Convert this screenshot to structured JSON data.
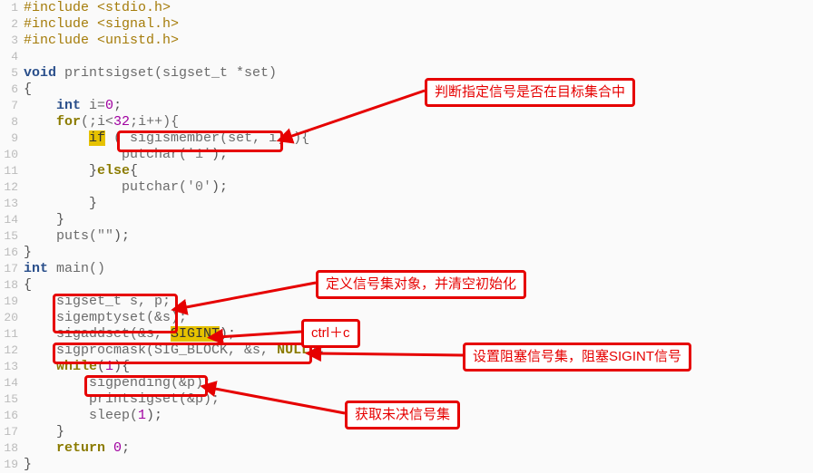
{
  "code": {
    "l1": "#include <stdio.h>",
    "l2": "#include <signal.h>",
    "l3": "#include <unistd.h>",
    "l4": "",
    "l5a": "void",
    "l5b": " printsigset(sigset_t *set)",
    "l6": "{",
    "l7a": "    ",
    "l7b": "int",
    "l7c": " i=",
    "l7d": "0",
    "l7e": ";",
    "l8a": "    ",
    "l8b": "for",
    "l8c": "(;i<",
    "l8d": "32",
    "l8e": ";i++){",
    "l9a": "        ",
    "l9b": "if",
    "l9c": " ( ",
    "l9d": "sigismember(set, i)",
    "l9e": " ){",
    "l10a": "            putchar(",
    "l10b": "'1'",
    "l10c": ");",
    "l11a": "        }",
    "l11b": "else",
    "l11c": "{",
    "l12a": "            putchar(",
    "l12b": "'0'",
    "l12c": ");",
    "l13": "        }",
    "l14": "    }",
    "l15a": "    puts(",
    "l15b": "\"\"",
    "l15c": ");",
    "l16": "}",
    "l17a": "int",
    "l17b": " main()",
    "l18": "{",
    "l19": "    sigset_t s, p;",
    "l20": "    sigemptyset(&s);",
    "l21a": "    sigaddset(&s, ",
    "l21b": "SIGINT",
    "l21c": ");",
    "l22a": "    ",
    "l22b": "sigprocmask(SIG_BLOCK, &s, ",
    "l22c": "NULL",
    "l22d": ")",
    "l22e": ";",
    "l23a": "    ",
    "l23b": "while",
    "l23c": "(",
    "l23d": "1",
    "l23e": "){",
    "l24": "        sigpending(&p);",
    "l25": "        printsigset(&p);",
    "l26a": "        sleep(",
    "l26b": "1",
    "l26c": ");",
    "l27": "    }",
    "l28a": "    ",
    "l28b": "return",
    "l28c": " ",
    "l28d": "0",
    "l28e": ";",
    "l29": "}"
  },
  "annot": {
    "a1": "判断指定信号是否在目标集合中",
    "a2": "定义信号集对象，并清空初始化",
    "a3": "ctrl＋c",
    "a4": "设置阻塞信号集，阻塞SIGINT信号",
    "a5": "获取未决信号集"
  },
  "lineno": {
    "n1": "1",
    "n2": "2",
    "n3": "3",
    "n4": "4",
    "n5": "5",
    "n6": "6",
    "n7": "7",
    "n8": "8",
    "n9": "9",
    "n10": "10",
    "n11": "11",
    "n12": "12",
    "n13": "13",
    "n14": "14",
    "n15": "15",
    "n16": "16",
    "n17": "17",
    "n18": "18",
    "n19": "19",
    "n20": "20",
    "n21": "11",
    "n22": "12",
    "n23": "13",
    "n24": "14",
    "n25": "15",
    "n26": "16",
    "n27": "17",
    "n28": "18",
    "n29": "19"
  }
}
